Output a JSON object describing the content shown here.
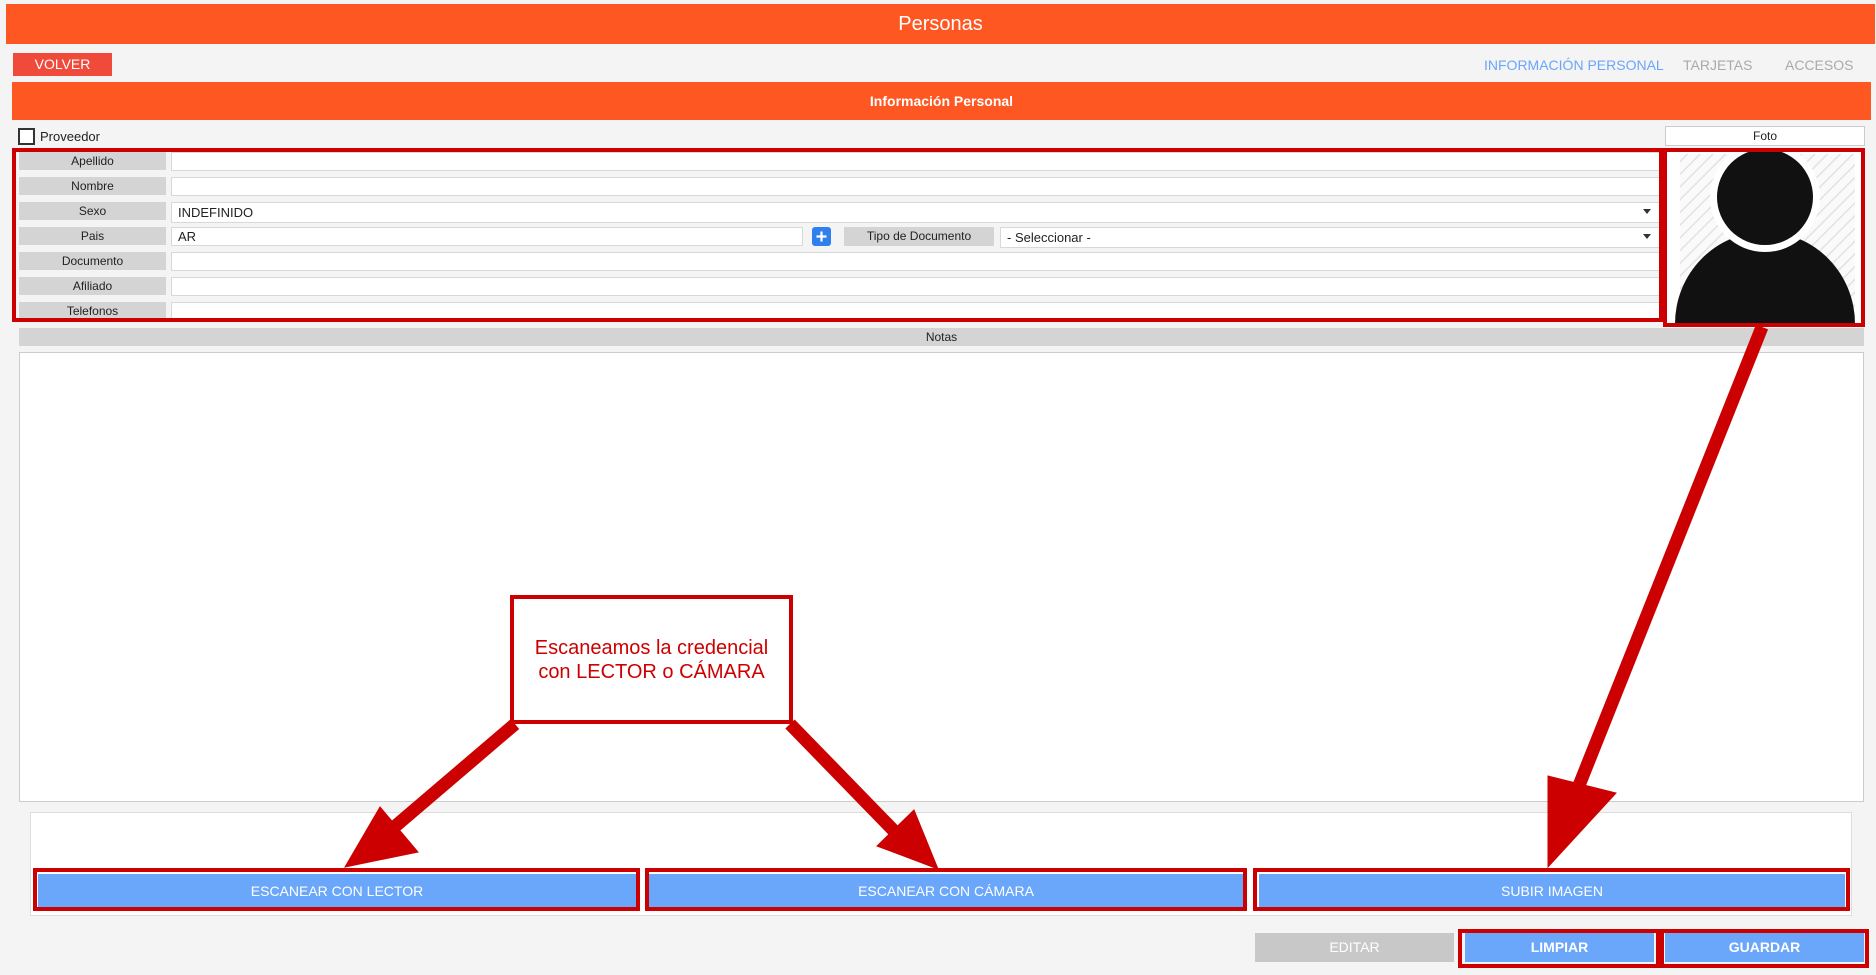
{
  "title": "Personas",
  "back_button": "VOLVER",
  "tabs": [
    {
      "label": "INFORMACIÓN PERSONAL",
      "active": true
    },
    {
      "label": "TARJETAS",
      "active": false
    },
    {
      "label": "ACCESOS",
      "active": false
    }
  ],
  "section_title": "Información Personal",
  "provider_checkbox": {
    "label": "Proveedor",
    "checked": false
  },
  "fields": {
    "apellido": {
      "label": "Apellido",
      "value": ""
    },
    "nombre": {
      "label": "Nombre",
      "value": ""
    },
    "sexo": {
      "label": "Sexo",
      "value": "INDEFINIDO"
    },
    "pais": {
      "label": "Pais",
      "value": "AR"
    },
    "tipo_documento": {
      "label": "Tipo de Documento",
      "value": "- Seleccionar -"
    },
    "documento": {
      "label": "Documento",
      "value": ""
    },
    "afiliado": {
      "label": "Afiliado",
      "value": ""
    },
    "telefonos": {
      "label": "Telefonos",
      "value": ""
    }
  },
  "add_icon": "plus-icon",
  "photo": {
    "label": "Foto",
    "icon": "user-silhouette-icon"
  },
  "notes": {
    "label": "Notas",
    "value": ""
  },
  "scan_buttons": {
    "lector": "ESCANEAR CON LECTOR",
    "camara": "ESCANEAR CON CÁMARA",
    "imagen": "SUBIR IMAGEN"
  },
  "actions": {
    "editar": "EDITAR",
    "limpiar": "LIMPIAR",
    "guardar": "GUARDAR"
  },
  "annotation": {
    "callout_text": "Escaneamos la credencial con LECTOR o CÁMARA",
    "highlight_color": "#cc0000"
  },
  "colors": {
    "primary": "#ff5722",
    "back_button": "#ef4a3a",
    "active_tab": "#6aa6fa",
    "scan_button": "#6aa6fa",
    "disabled_button": "#c8c8c8"
  }
}
